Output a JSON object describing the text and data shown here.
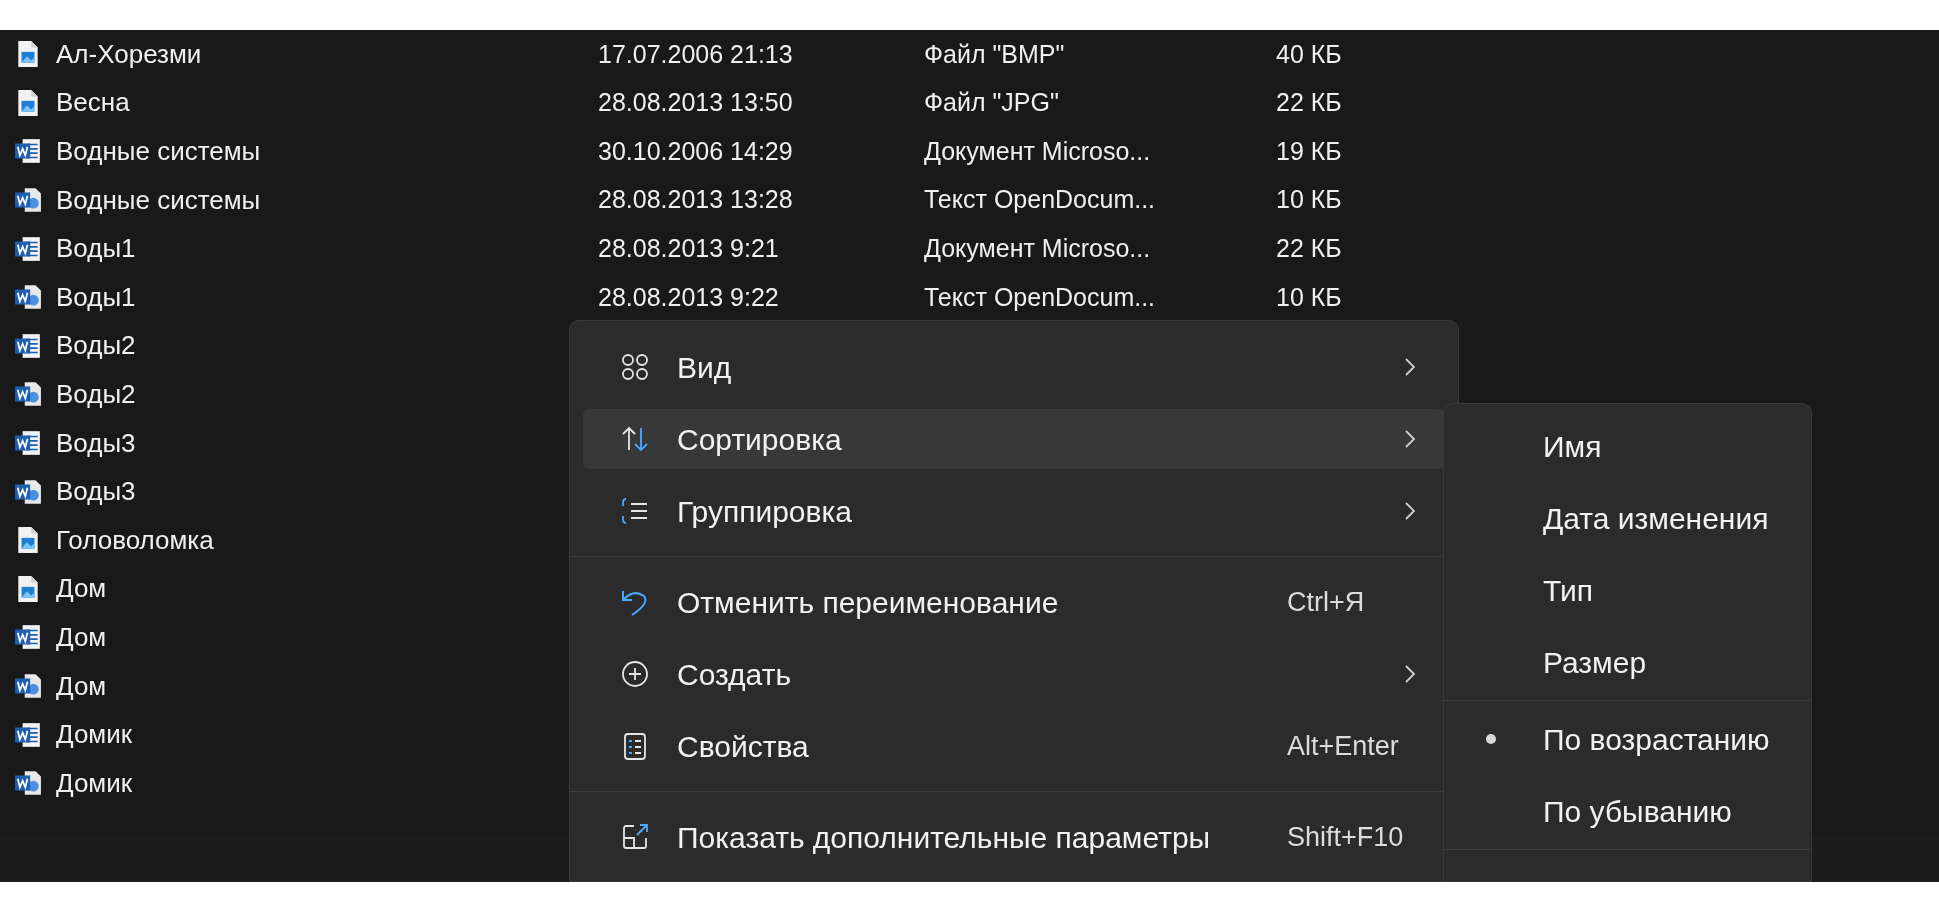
{
  "files": [
    {
      "name": "Ал-Хорезми",
      "kind": "image",
      "date": "17.07.2006 21:13",
      "type": "Файл \"BMP\"",
      "size": "40 КБ"
    },
    {
      "name": "Весна",
      "kind": "image",
      "date": "28.08.2013 13:50",
      "type": "Файл \"JPG\"",
      "size": "22 КБ"
    },
    {
      "name": "Водные системы",
      "kind": "word",
      "date": "30.10.2006 14:29",
      "type": "Документ Microso...",
      "size": "19 КБ"
    },
    {
      "name": "Водные системы",
      "kind": "odt",
      "date": "28.08.2013 13:28",
      "type": "Текст OpenDocum...",
      "size": "10 КБ"
    },
    {
      "name": "Воды1",
      "kind": "word",
      "date": "28.08.2013 9:21",
      "type": "Документ Microso...",
      "size": "22 КБ"
    },
    {
      "name": "Воды1",
      "kind": "odt",
      "date": "28.08.2013 9:22",
      "type": "Текст OpenDocum...",
      "size": "10 КБ"
    },
    {
      "name": "Воды2",
      "kind": "word"
    },
    {
      "name": "Воды2",
      "kind": "odt"
    },
    {
      "name": "Воды3",
      "kind": "word"
    },
    {
      "name": "Воды3",
      "kind": "odt"
    },
    {
      "name": "Головоломка",
      "kind": "image"
    },
    {
      "name": "Дом",
      "kind": "image"
    },
    {
      "name": "Дом",
      "kind": "word"
    },
    {
      "name": "Дом",
      "kind": "odt"
    },
    {
      "name": "Домик",
      "kind": "word"
    },
    {
      "name": "Домик",
      "kind": "odt"
    }
  ],
  "context_menu": {
    "items": [
      {
        "kind": "submenu",
        "label": "Вид",
        "selected": false
      },
      {
        "kind": "submenu",
        "label": "Сортировка",
        "selected": true
      },
      {
        "kind": "submenu",
        "label": "Группировка",
        "selected": false
      },
      {
        "kind": "separator"
      },
      {
        "kind": "command",
        "label": "Отменить переименование",
        "shortcut": "Ctrl+Я",
        "selected": false
      },
      {
        "kind": "submenu",
        "label": "Создать",
        "selected": false
      },
      {
        "kind": "command",
        "label": "Свойства",
        "shortcut": "Alt+Enter",
        "selected": false
      },
      {
        "kind": "separator"
      },
      {
        "kind": "command",
        "label": "Показать дополнительные параметры",
        "shortcut": "Shift+F10",
        "selected": false
      }
    ]
  },
  "sort_submenu": {
    "items": [
      {
        "kind": "item",
        "label": "Имя",
        "checked": false
      },
      {
        "kind": "item",
        "label": "Дата изменения",
        "checked": false
      },
      {
        "kind": "item",
        "label": "Тип",
        "checked": false
      },
      {
        "kind": "item",
        "label": "Размер",
        "checked": false
      },
      {
        "kind": "separator"
      },
      {
        "kind": "item",
        "label": "По возрастанию",
        "checked": true
      },
      {
        "kind": "item",
        "label": "По убыванию",
        "checked": false
      },
      {
        "kind": "separator"
      }
    ]
  }
}
